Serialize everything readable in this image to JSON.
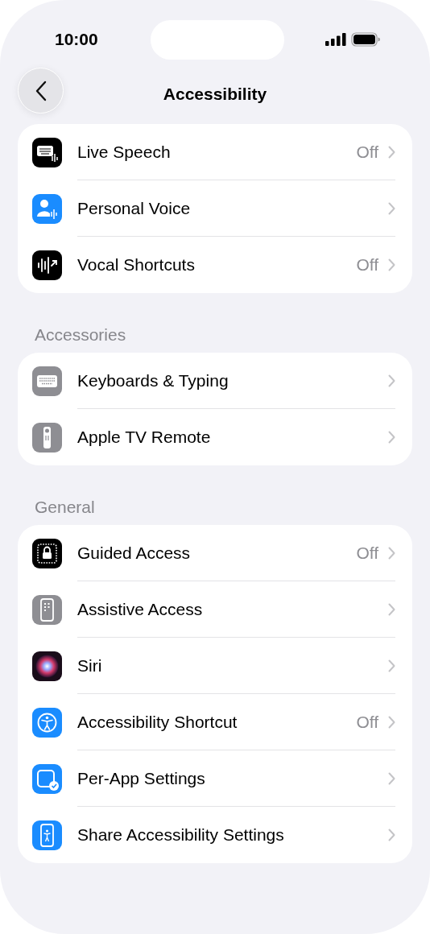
{
  "status_bar": {
    "time": "10:00"
  },
  "nav": {
    "title": "Accessibility"
  },
  "groups": [
    {
      "items": [
        {
          "label": "Live Speech",
          "value": "Off",
          "kind": "keyboard-wave"
        },
        {
          "label": "Personal Voice",
          "kind": "person-wave"
        },
        {
          "label": "Vocal Shortcuts",
          "value": "Off",
          "kind": "waveform"
        }
      ]
    },
    {
      "header": "Accessories",
      "items": [
        {
          "label": "Keyboards & Typing",
          "kind": "keyboard"
        },
        {
          "label": "Apple TV Remote",
          "kind": "remote"
        }
      ]
    },
    {
      "header": "General",
      "items": [
        {
          "label": "Guided Access",
          "value": "Off",
          "kind": "lock"
        },
        {
          "label": "Assistive Access",
          "kind": "grid-phone"
        },
        {
          "label": "Siri",
          "kind": "orb"
        },
        {
          "label": "Accessibility Shortcut",
          "value": "Off",
          "kind": "figure"
        },
        {
          "label": "Per-App Settings",
          "kind": "square-check"
        },
        {
          "label": "Share Accessibility Settings",
          "kind": "phone-figure"
        }
      ]
    }
  ]
}
